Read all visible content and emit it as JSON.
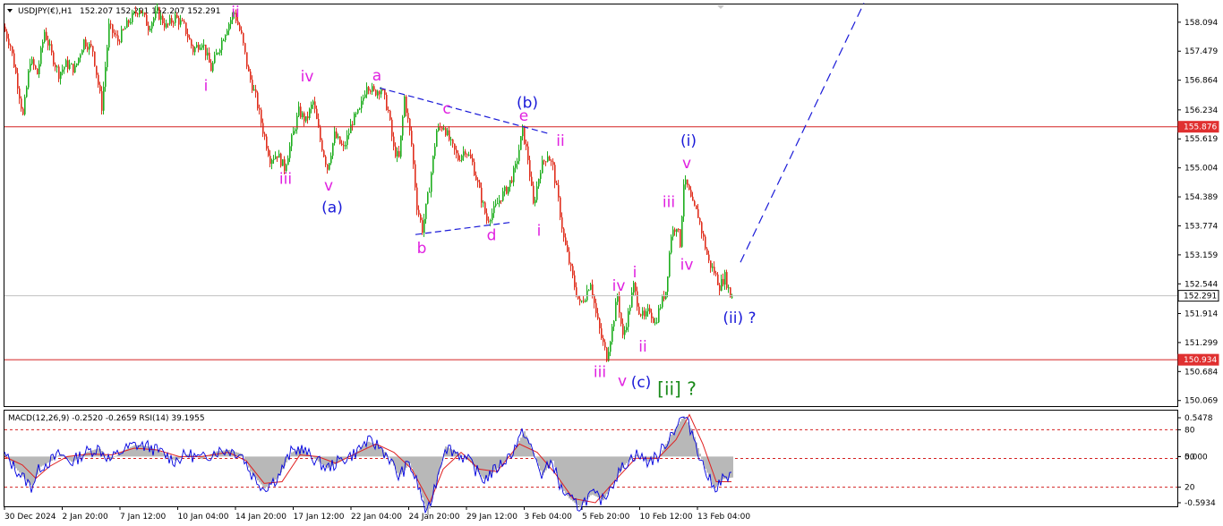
{
  "header": {
    "symbol_label": "USDJPY(€),H1",
    "quote": "152.207 152.291 152.207 152.291",
    "indicator_label": "MACD(12,26,9) -0.2520 -0.2659 RSI(14) 39.1955"
  },
  "colors": {
    "bull_candle": "#1fae1f",
    "bear_candle": "#e0301e",
    "wave_magenta": "#e020e0",
    "wave_blue": "#1a1ad8",
    "wave_green": "#1a8a1a",
    "level_line": "#d42020",
    "trend_dash": "#1a1ad8",
    "macd_line": "#0000e0",
    "macd_signal": "#e02020",
    "histogram": "#b8b8b8",
    "tag_current_bg": "#ffffff",
    "tag_level_bg": "#e03030"
  },
  "chart_data": [
    {
      "type": "candlestick",
      "title": "USDJPY(€),H1",
      "y_ticks": [
        "158.094",
        "157.479",
        "156.864",
        "156.234",
        "155.619",
        "155.004",
        "154.389",
        "153.774",
        "153.159",
        "152.544",
        "151.914",
        "151.299",
        "150.684",
        "150.069"
      ],
      "ylim": [
        149.95,
        158.47
      ],
      "x_ticks": [
        "30 Dec 2024",
        "2 Jan 20:00",
        "7 Jan 12:00",
        "10 Jan 04:00",
        "14 Jan 20:00",
        "17 Jan 12:00",
        "22 Jan 04:00",
        "24 Jan 20:00",
        "29 Jan 12:00",
        "3 Feb 04:00",
        "5 Feb 20:00",
        "10 Feb 12:00",
        "13 Feb 04:00"
      ],
      "current_price": "152.291",
      "horizontal_levels": [
        {
          "value": 155.876,
          "label": "155.876"
        },
        {
          "value": 150.934,
          "label": "150.934"
        }
      ],
      "price_path": [
        {
          "x": 0,
          "y": 158.0
        },
        {
          "x": 8,
          "y": 157.6
        },
        {
          "x": 15,
          "y": 156.9
        },
        {
          "x": 22,
          "y": 156.1
        },
        {
          "x": 30,
          "y": 157.3
        },
        {
          "x": 38,
          "y": 157.0
        },
        {
          "x": 46,
          "y": 157.9
        },
        {
          "x": 54,
          "y": 157.4
        },
        {
          "x": 62,
          "y": 157.0
        },
        {
          "x": 70,
          "y": 157.2
        },
        {
          "x": 80,
          "y": 157.1
        },
        {
          "x": 90,
          "y": 157.7
        },
        {
          "x": 100,
          "y": 157.5
        },
        {
          "x": 110,
          "y": 156.3
        },
        {
          "x": 118,
          "y": 158.0
        },
        {
          "x": 128,
          "y": 157.7
        },
        {
          "x": 140,
          "y": 158.1
        },
        {
          "x": 152,
          "y": 158.4
        },
        {
          "x": 162,
          "y": 158.0
        },
        {
          "x": 172,
          "y": 158.3
        },
        {
          "x": 182,
          "y": 158.0
        },
        {
          "x": 192,
          "y": 158.2
        },
        {
          "x": 202,
          "y": 158.0
        },
        {
          "x": 212,
          "y": 157.5
        },
        {
          "x": 222,
          "y": 157.7
        },
        {
          "x": 232,
          "y": 157.1
        },
        {
          "x": 242,
          "y": 157.6
        },
        {
          "x": 250,
          "y": 158.0
        },
        {
          "x": 258,
          "y": 158.3
        },
        {
          "x": 266,
          "y": 157.8
        },
        {
          "x": 274,
          "y": 157.0
        },
        {
          "x": 282,
          "y": 156.5
        },
        {
          "x": 290,
          "y": 155.8
        },
        {
          "x": 298,
          "y": 155.2
        },
        {
          "x": 306,
          "y": 155.3
        },
        {
          "x": 314,
          "y": 155.0
        },
        {
          "x": 322,
          "y": 155.6
        },
        {
          "x": 330,
          "y": 156.2
        },
        {
          "x": 338,
          "y": 156.0
        },
        {
          "x": 346,
          "y": 156.4
        },
        {
          "x": 354,
          "y": 155.6
        },
        {
          "x": 362,
          "y": 155.0
        },
        {
          "x": 370,
          "y": 155.7
        },
        {
          "x": 380,
          "y": 155.4
        },
        {
          "x": 390,
          "y": 156.0
        },
        {
          "x": 398,
          "y": 156.2
        },
        {
          "x": 406,
          "y": 156.8
        },
        {
          "x": 414,
          "y": 156.6
        },
        {
          "x": 422,
          "y": 156.7
        },
        {
          "x": 430,
          "y": 156.2
        },
        {
          "x": 436,
          "y": 155.4
        },
        {
          "x": 442,
          "y": 155.2
        },
        {
          "x": 448,
          "y": 156.5
        },
        {
          "x": 456,
          "y": 155.5
        },
        {
          "x": 462,
          "y": 154.2
        },
        {
          "x": 468,
          "y": 153.7
        },
        {
          "x": 476,
          "y": 154.6
        },
        {
          "x": 484,
          "y": 155.8
        },
        {
          "x": 492,
          "y": 155.9
        },
        {
          "x": 500,
          "y": 155.5
        },
        {
          "x": 508,
          "y": 155.2
        },
        {
          "x": 516,
          "y": 155.4
        },
        {
          "x": 524,
          "y": 155.1
        },
        {
          "x": 532,
          "y": 154.5
        },
        {
          "x": 540,
          "y": 153.9
        },
        {
          "x": 548,
          "y": 154.1
        },
        {
          "x": 556,
          "y": 154.4
        },
        {
          "x": 564,
          "y": 154.6
        },
        {
          "x": 572,
          "y": 155.0
        },
        {
          "x": 580,
          "y": 155.8
        },
        {
          "x": 586,
          "y": 155.2
        },
        {
          "x": 592,
          "y": 154.2
        },
        {
          "x": 600,
          "y": 155.0
        },
        {
          "x": 608,
          "y": 155.3
        },
        {
          "x": 614,
          "y": 155.0
        },
        {
          "x": 620,
          "y": 154.3
        },
        {
          "x": 626,
          "y": 153.5
        },
        {
          "x": 632,
          "y": 153.0
        },
        {
          "x": 638,
          "y": 152.5
        },
        {
          "x": 644,
          "y": 152.1
        },
        {
          "x": 650,
          "y": 152.3
        },
        {
          "x": 656,
          "y": 152.6
        },
        {
          "x": 662,
          "y": 151.9
        },
        {
          "x": 668,
          "y": 151.4
        },
        {
          "x": 674,
          "y": 151.0
        },
        {
          "x": 680,
          "y": 151.6
        },
        {
          "x": 686,
          "y": 152.3
        },
        {
          "x": 692,
          "y": 151.4
        },
        {
          "x": 698,
          "y": 151.9
        },
        {
          "x": 704,
          "y": 152.5
        },
        {
          "x": 710,
          "y": 152.0
        },
        {
          "x": 716,
          "y": 151.8
        },
        {
          "x": 722,
          "y": 152.0
        },
        {
          "x": 728,
          "y": 151.7
        },
        {
          "x": 734,
          "y": 152.1
        },
        {
          "x": 740,
          "y": 152.4
        },
        {
          "x": 746,
          "y": 153.6
        },
        {
          "x": 752,
          "y": 153.8
        },
        {
          "x": 756,
          "y": 153.4
        },
        {
          "x": 760,
          "y": 154.7
        },
        {
          "x": 764,
          "y": 154.6
        },
        {
          "x": 770,
          "y": 154.2
        },
        {
          "x": 776,
          "y": 154.0
        },
        {
          "x": 782,
          "y": 153.5
        },
        {
          "x": 788,
          "y": 153.0
        },
        {
          "x": 794,
          "y": 152.8
        },
        {
          "x": 800,
          "y": 152.5
        },
        {
          "x": 806,
          "y": 152.7
        },
        {
          "x": 812,
          "y": 152.3
        }
      ],
      "wave_labels": [
        {
          "text": "ii",
          "x": 258,
          "y": 158.32,
          "style": "magenta"
        },
        {
          "text": "i",
          "x": 225,
          "y": 156.75,
          "style": "magenta"
        },
        {
          "text": "iv",
          "x": 338,
          "y": 156.95,
          "style": "magenta"
        },
        {
          "text": "iii",
          "x": 314,
          "y": 154.78,
          "style": "magenta"
        },
        {
          "text": "v",
          "x": 362,
          "y": 154.64,
          "style": "magenta"
        },
        {
          "text": "(a)",
          "x": 366,
          "y": 154.17,
          "style": "blue"
        },
        {
          "text": "a",
          "x": 416,
          "y": 156.97,
          "style": "magenta"
        },
        {
          "text": "c",
          "x": 494,
          "y": 156.27,
          "style": "magenta"
        },
        {
          "text": "(b)",
          "x": 584,
          "y": 156.39,
          "style": "blue"
        },
        {
          "text": "e",
          "x": 580,
          "y": 156.12,
          "style": "magenta"
        },
        {
          "text": "ii",
          "x": 621,
          "y": 155.59,
          "style": "magenta"
        },
        {
          "text": "b",
          "x": 466,
          "y": 153.31,
          "style": "magenta"
        },
        {
          "text": "d",
          "x": 544,
          "y": 153.58,
          "style": "magenta"
        },
        {
          "text": "i",
          "x": 597,
          "y": 153.68,
          "style": "magenta"
        },
        {
          "text": "(i)",
          "x": 764,
          "y": 155.59,
          "style": "blue"
        },
        {
          "text": "v",
          "x": 762,
          "y": 155.11,
          "style": "magenta"
        },
        {
          "text": "iii",
          "x": 742,
          "y": 154.29,
          "style": "magenta"
        },
        {
          "text": "iv",
          "x": 762,
          "y": 152.96,
          "style": "magenta"
        },
        {
          "text": "i",
          "x": 704,
          "y": 152.8,
          "style": "magenta"
        },
        {
          "text": "iv",
          "x": 686,
          "y": 152.51,
          "style": "magenta"
        },
        {
          "text": "ii",
          "x": 713,
          "y": 151.22,
          "style": "magenta"
        },
        {
          "text": "iii",
          "x": 665,
          "y": 150.68,
          "style": "magenta"
        },
        {
          "text": "v",
          "x": 690,
          "y": 150.49,
          "style": "magenta"
        },
        {
          "text": "(c)",
          "x": 711,
          "y": 150.46,
          "style": "blue"
        },
        {
          "text": "(ii) ?",
          "x": 821,
          "y": 151.83,
          "style": "blue"
        },
        {
          "text": "[ii] ?",
          "x": 751,
          "y": 150.3,
          "style": "green"
        }
      ],
      "triangle_lines": [
        {
          "x1": 419,
          "y1": 156.7,
          "x2": 608,
          "y2": 155.73
        },
        {
          "x1": 459,
          "y1": 153.59,
          "x2": 566,
          "y2": 153.85
        }
      ],
      "projection_line": {
        "x1": 822,
        "y1": 153.0,
        "x2": 960,
        "y2": 158.5
      }
    },
    {
      "type": "line",
      "title": "MACD(12,26,9) -0.2520 -0.2659 RSI(14) 39.1955",
      "y_ticks_left_axis": [
        "0.5478",
        "80",
        "0.000",
        "50",
        "20",
        "-0.5934"
      ],
      "rsi_levels": [
        80,
        50,
        20
      ],
      "series": [
        {
          "name": "MACD(12,26,9)",
          "role": "main_and_histogram"
        },
        {
          "name": "RSI(14)",
          "role": "overlay"
        }
      ],
      "macd_path": [
        {
          "x": 0,
          "y": 0.02
        },
        {
          "x": 15,
          "y": -0.18
        },
        {
          "x": 30,
          "y": -0.36
        },
        {
          "x": 40,
          "y": -0.12
        },
        {
          "x": 52,
          "y": -0.05
        },
        {
          "x": 62,
          "y": 0.03
        },
        {
          "x": 75,
          "y": -0.07
        },
        {
          "x": 90,
          "y": 0.05
        },
        {
          "x": 105,
          "y": 0.1
        },
        {
          "x": 118,
          "y": -0.04
        },
        {
          "x": 130,
          "y": 0.06
        },
        {
          "x": 145,
          "y": 0.14
        },
        {
          "x": 160,
          "y": 0.12
        },
        {
          "x": 175,
          "y": 0.05
        },
        {
          "x": 190,
          "y": -0.05
        },
        {
          "x": 205,
          "y": 0.03
        },
        {
          "x": 220,
          "y": -0.03
        },
        {
          "x": 235,
          "y": 0.06
        },
        {
          "x": 250,
          "y": 0.08
        },
        {
          "x": 265,
          "y": 0.03
        },
        {
          "x": 275,
          "y": -0.2
        },
        {
          "x": 290,
          "y": -0.38
        },
        {
          "x": 305,
          "y": -0.25
        },
        {
          "x": 320,
          "y": 0.05
        },
        {
          "x": 330,
          "y": 0.1
        },
        {
          "x": 345,
          "y": -0.02
        },
        {
          "x": 360,
          "y": -0.14
        },
        {
          "x": 375,
          "y": -0.05
        },
        {
          "x": 390,
          "y": 0.03
        },
        {
          "x": 405,
          "y": 0.18
        },
        {
          "x": 418,
          "y": 0.13
        },
        {
          "x": 430,
          "y": -0.02
        },
        {
          "x": 440,
          "y": -0.24
        },
        {
          "x": 452,
          "y": -0.08
        },
        {
          "x": 462,
          "y": -0.35
        },
        {
          "x": 472,
          "y": -0.7
        },
        {
          "x": 482,
          "y": -0.3
        },
        {
          "x": 492,
          "y": 0.12
        },
        {
          "x": 505,
          "y": 0.05
        },
        {
          "x": 520,
          "y": -0.07
        },
        {
          "x": 535,
          "y": -0.28
        },
        {
          "x": 550,
          "y": -0.14
        },
        {
          "x": 565,
          "y": 0.02
        },
        {
          "x": 580,
          "y": 0.3
        },
        {
          "x": 590,
          "y": 0.05
        },
        {
          "x": 600,
          "y": -0.22
        },
        {
          "x": 612,
          "y": -0.05
        },
        {
          "x": 620,
          "y": -0.35
        },
        {
          "x": 630,
          "y": -0.5
        },
        {
          "x": 642,
          "y": -0.6
        },
        {
          "x": 655,
          "y": -0.45
        },
        {
          "x": 668,
          "y": -0.52
        },
        {
          "x": 680,
          "y": -0.3
        },
        {
          "x": 692,
          "y": -0.1
        },
        {
          "x": 705,
          "y": 0.03
        },
        {
          "x": 718,
          "y": -0.06
        },
        {
          "x": 730,
          "y": 0.0
        },
        {
          "x": 745,
          "y": 0.28
        },
        {
          "x": 758,
          "y": 0.48
        },
        {
          "x": 768,
          "y": 0.3
        },
        {
          "x": 780,
          "y": -0.1
        },
        {
          "x": 792,
          "y": -0.38
        },
        {
          "x": 802,
          "y": -0.27
        },
        {
          "x": 812,
          "y": -0.25
        }
      ],
      "signal_path": [
        {
          "x": 0,
          "y": 0.0
        },
        {
          "x": 20,
          "y": -0.1
        },
        {
          "x": 35,
          "y": -0.26
        },
        {
          "x": 50,
          "y": -0.12
        },
        {
          "x": 70,
          "y": 0.0
        },
        {
          "x": 95,
          "y": 0.03
        },
        {
          "x": 120,
          "y": 0.02
        },
        {
          "x": 145,
          "y": 0.1
        },
        {
          "x": 170,
          "y": 0.08
        },
        {
          "x": 195,
          "y": 0.0
        },
        {
          "x": 220,
          "y": 0.0
        },
        {
          "x": 250,
          "y": 0.05
        },
        {
          "x": 270,
          "y": -0.05
        },
        {
          "x": 290,
          "y": -0.32
        },
        {
          "x": 310,
          "y": -0.3
        },
        {
          "x": 330,
          "y": 0.02
        },
        {
          "x": 350,
          "y": 0.0
        },
        {
          "x": 370,
          "y": -0.08
        },
        {
          "x": 395,
          "y": 0.05
        },
        {
          "x": 415,
          "y": 0.15
        },
        {
          "x": 435,
          "y": 0.05
        },
        {
          "x": 455,
          "y": -0.15
        },
        {
          "x": 475,
          "y": -0.55
        },
        {
          "x": 490,
          "y": -0.15
        },
        {
          "x": 510,
          "y": 0.05
        },
        {
          "x": 530,
          "y": -0.15
        },
        {
          "x": 550,
          "y": -0.18
        },
        {
          "x": 575,
          "y": 0.15
        },
        {
          "x": 595,
          "y": 0.05
        },
        {
          "x": 615,
          "y": -0.2
        },
        {
          "x": 635,
          "y": -0.5
        },
        {
          "x": 660,
          "y": -0.55
        },
        {
          "x": 685,
          "y": -0.25
        },
        {
          "x": 705,
          "y": -0.02
        },
        {
          "x": 730,
          "y": -0.02
        },
        {
          "x": 750,
          "y": 0.2
        },
        {
          "x": 765,
          "y": 0.5
        },
        {
          "x": 780,
          "y": 0.15
        },
        {
          "x": 795,
          "y": -0.3
        },
        {
          "x": 812,
          "y": -0.3
        }
      ]
    }
  ]
}
